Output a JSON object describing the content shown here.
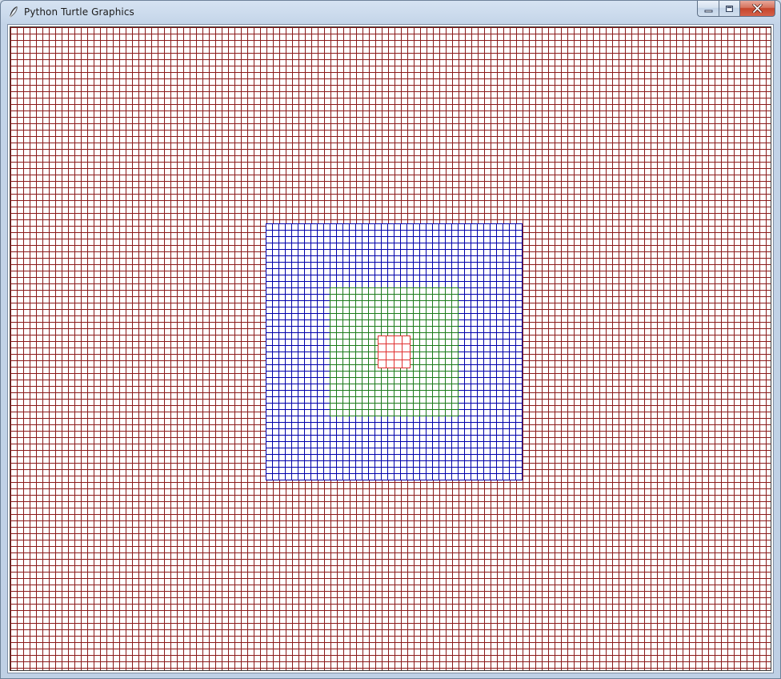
{
  "window": {
    "title": "Python Turtle Graphics"
  },
  "icons": {
    "app": "feather-icon",
    "minimize": "minimize-icon",
    "maximize": "maximize-icon",
    "close": "close-icon"
  },
  "canvas": {
    "background": "#ffffff",
    "grid_layers": [
      {
        "name": "outer",
        "color": "#8b1a1a",
        "cell": 8
      },
      {
        "name": "blue",
        "color": "#0000aa",
        "cell": 8
      },
      {
        "name": "green",
        "color": "#1b7a1b",
        "cell": 8
      },
      {
        "name": "red",
        "color": "#e03030",
        "cell": 10
      }
    ]
  }
}
